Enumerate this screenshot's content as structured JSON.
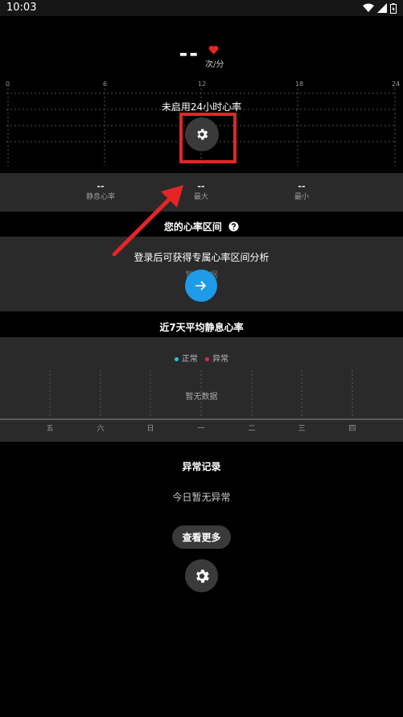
{
  "status_bar": {
    "time": "10:03"
  },
  "heart_rate": {
    "value": "--",
    "unit": "次/分",
    "icon": "heart-icon",
    "heart_color": "#e52525"
  },
  "day_chart": {
    "axis_labels": [
      "0",
      "6",
      "12",
      "18",
      "24"
    ],
    "message": "未启用24小时心率",
    "settings_icon": "gear-icon",
    "highlight_color": "#e52525"
  },
  "stats": [
    {
      "value": "--",
      "label": "静息心率"
    },
    {
      "value": "--",
      "label": "最大"
    },
    {
      "value": "--",
      "label": "最小"
    }
  ],
  "zones": {
    "title": "您的心率区间",
    "help_icon": "question-icon",
    "login_text": "登录后可获得专属心率区间分析",
    "no_data": "暂无数据",
    "action_icon": "arrow-right-icon",
    "action_color": "#1e9be8"
  },
  "resting_week": {
    "title": "近7天平均静息心率",
    "legend": [
      {
        "label": "正常",
        "color": "#1fc6e8"
      },
      {
        "label": "异常",
        "color": "#e8264a"
      }
    ],
    "no_data": "暂无数据",
    "days": [
      "五",
      "六",
      "日",
      "一",
      "二",
      "三",
      "四"
    ]
  },
  "abnormal": {
    "title": "异常记录",
    "none_text": "今日暂无异常",
    "more_label": "查看更多",
    "settings_icon": "gear-icon"
  }
}
